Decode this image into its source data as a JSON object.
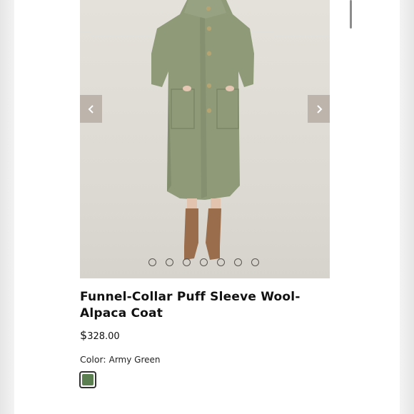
{
  "gallery": {
    "prev_icon": "chevron-left-icon",
    "next_icon": "chevron-right-icon",
    "dot_count": 7,
    "coat_color": "#8e9a78",
    "boot_color": "#9a6e4c"
  },
  "product": {
    "title": "Funnel-Collar Puff Sleeve Wool-Alpaca Coat",
    "price_symbol": "$",
    "price_value": "328.00",
    "color_label": "Color:",
    "color_value": "Army Green",
    "swatch_color": "#5c7f51"
  }
}
